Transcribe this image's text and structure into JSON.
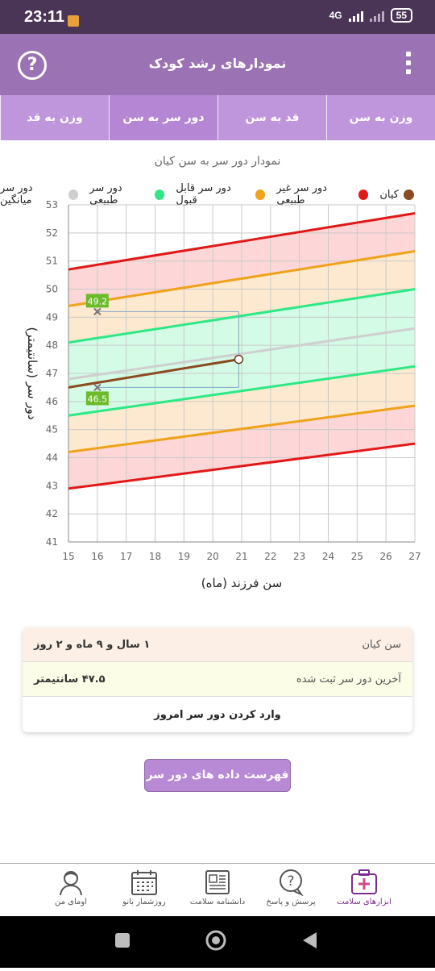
{
  "status_bar": {
    "time": "23:11",
    "network": "4G",
    "battery": "55"
  },
  "app_bar": {
    "title": "نمودارهای رشد کودک",
    "help_icon": "question-mark-icon",
    "menu_icon": "more-vertical-icon"
  },
  "tabs": [
    {
      "label": "وزن به سن",
      "active": false
    },
    {
      "label": "قد به سن",
      "active": false
    },
    {
      "label": "دور سر به سن",
      "active": true
    },
    {
      "label": "وزن به قد",
      "active": false
    }
  ],
  "chart_title": "نمودار دور سر به سن کیان",
  "legend": [
    {
      "label": "کیان",
      "color": "#8b4a1f"
    },
    {
      "label": "دور سر غیر طبیعی",
      "color": "#e21818"
    },
    {
      "label": "دور سر قابل قبول",
      "color": "#f0a21a"
    },
    {
      "label": "دور سر طبیعی",
      "color": "#2ee886"
    },
    {
      "label": "دور سر میانگین",
      "color": "#cfcfcf"
    }
  ],
  "chart_data": {
    "type": "line",
    "xlabel": "سن فرزند (ماه)",
    "ylabel": "دور سر (سانتیمتر)",
    "xlim": [
      15,
      27
    ],
    "ylim": [
      41,
      53
    ],
    "x_ticks": [
      15,
      16,
      17,
      18,
      19,
      20,
      21,
      22,
      23,
      24,
      25,
      26,
      27
    ],
    "y_ticks": [
      41,
      42,
      43,
      44,
      45,
      46,
      47,
      48,
      49,
      50,
      51,
      52,
      53
    ],
    "grid": true,
    "series": [
      {
        "name": "دور سر غیر طبیعی",
        "color": "#e21818",
        "x": [
          15,
          27
        ],
        "y": [
          50.7,
          52.7
        ]
      },
      {
        "name": "دور سر قابل قبول",
        "color": "#f0a21a",
        "x": [
          15,
          27
        ],
        "y": [
          49.4,
          51.35
        ]
      },
      {
        "name": "دور سر طبیعی",
        "color": "#2ee886",
        "x": [
          15,
          27
        ],
        "y": [
          48.1,
          50.0
        ]
      },
      {
        "name": "دور سر میانگین",
        "color": "#cfcfcf",
        "x": [
          15,
          27
        ],
        "y": [
          46.8,
          48.6
        ]
      },
      {
        "name": "دور سر طبیعی",
        "color": "#2ee886",
        "x": [
          15,
          27
        ],
        "y": [
          45.5,
          47.25
        ]
      },
      {
        "name": "دور سر قابل قبول",
        "color": "#f0a21a",
        "x": [
          15,
          27
        ],
        "y": [
          44.2,
          45.85
        ]
      },
      {
        "name": "دور سر غیر طبیعی",
        "color": "#e21818",
        "x": [
          15,
          27
        ],
        "y": [
          42.9,
          44.5
        ]
      },
      {
        "name": "کیان",
        "color": "#8b4a1f",
        "x": [
          15,
          20.9
        ],
        "y": [
          46.5,
          47.5
        ]
      }
    ],
    "crosshair": {
      "x": 20.9,
      "y_top": 49.2,
      "y_bottom": 46.5,
      "x_marker": 16
    },
    "annotations": [
      "49.2",
      "46.5"
    ]
  },
  "info": {
    "age_label": "سن کیان",
    "age_value": "۱ سال و ۹ ماه و ۲ روز",
    "last_label": "آخرین دور سر ثبت شده",
    "last_value": "۴۷.۵ سانتیمتر",
    "enter_today": "وارد کردن دور سر امروز"
  },
  "list_button": "فهرست داده های دور سر کیان",
  "bottom_nav": [
    {
      "label": "ابزارهای سلامت",
      "icon": "medical-kit-icon",
      "active": true
    },
    {
      "label": "پرسش و پاسخ",
      "icon": "question-bubble-icon",
      "active": false
    },
    {
      "label": "دانشنامه سلامت",
      "icon": "newspaper-icon",
      "active": false
    },
    {
      "label": "روزشمار بانو",
      "icon": "calendar-icon",
      "active": false
    },
    {
      "label": "اومای من",
      "icon": "user-icon",
      "active": false
    }
  ]
}
